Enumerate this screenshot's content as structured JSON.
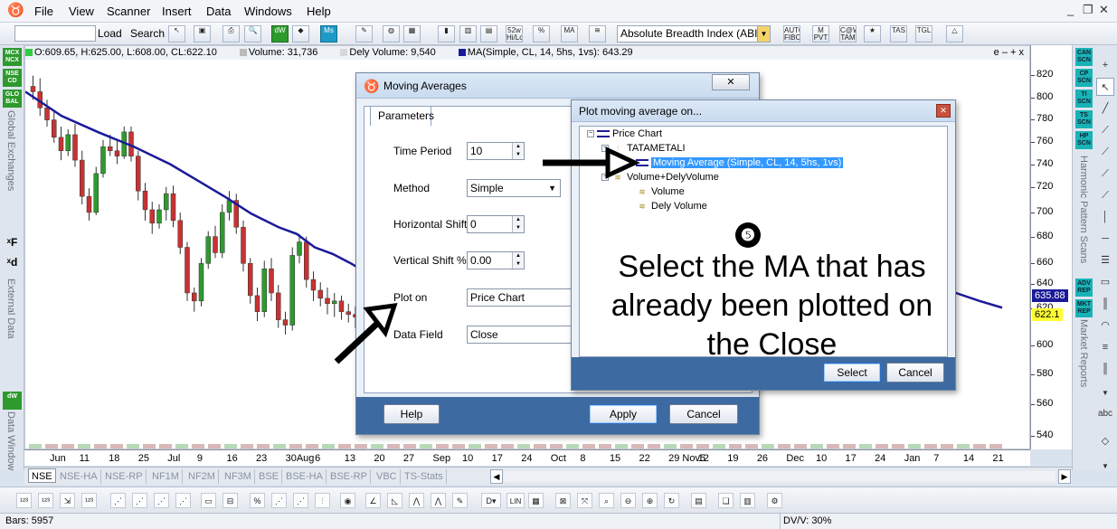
{
  "menu": {
    "items": [
      "File",
      "View",
      "Scanner",
      "Insert",
      "Data",
      "Windows",
      "Help"
    ],
    "window_controls": [
      "_",
      "❐",
      "✕"
    ]
  },
  "toolbar": {
    "load_label": "Load",
    "search_label": "Search",
    "indicator_combo": "Absolute Breadth Index (ABI",
    "icons": [
      "dW",
      "Ms",
      "52w Hi/Lo",
      "MA",
      "AUTO FIBO",
      "M PVT",
      "C@W TAM",
      "TAS",
      "TGL"
    ]
  },
  "left_strip": {
    "badges": [
      "MCX NCX",
      "NSE CD",
      "GLO BAL",
      "dW"
    ],
    "labels": [
      "Global Exchanges",
      "External Data",
      "Data Window"
    ],
    "xf": "ˣF",
    "xd": "ˣd"
  },
  "right_strip": {
    "badges": [
      "CAN SCN",
      "CP SCN",
      "TI SCN",
      "TS SCN",
      "HP SCN",
      "ADV REP",
      "MKT REP"
    ],
    "labels": [
      "Harmonic Pattern Scans",
      "Market Reports"
    ],
    "abc": "abc"
  },
  "legend": {
    "ohlc": "O:609.65, H:625.00, L:608.00, CL:622.10",
    "volume": "Volume: 31,736",
    "dely_volume": "Dely Volume: 9,540",
    "ma": "MA(Simple, CL, 14, 5hs, 1vs): 643.29",
    "controls": "e – + x",
    "colors": {
      "ohlc": "#2ecc40",
      "volume": "#bbbbbb",
      "dely": "#d8d8d8",
      "ma": "#1a1a99"
    }
  },
  "y_axis": {
    "ticks": [
      "820",
      "800",
      "780",
      "760",
      "740",
      "720",
      "700",
      "680",
      "660",
      "640",
      "620",
      "600",
      "580",
      "560",
      "540"
    ],
    "price_ma": "635.88",
    "price_close": "622.1"
  },
  "x_axis": {
    "ticks": [
      "Jun",
      "11",
      "18",
      "25",
      "Jul",
      "9",
      "16",
      "23",
      "30Aug",
      "6",
      "13",
      "20",
      "27",
      "Sep",
      "10",
      "17",
      "24",
      "Oct",
      "8",
      "15",
      "22",
      "29 Nov5",
      "12",
      "19",
      "26",
      "Dec",
      "10",
      "17",
      "24",
      "Jan",
      "7",
      "14",
      "21"
    ]
  },
  "chart_data": {
    "type": "candlestick",
    "ylim": [
      530,
      830
    ],
    "ma_color": "#1a1a99",
    "up_color": "#2e9a2e",
    "down_color": "#c83232",
    "candles": [
      [
        800,
        808,
        790,
        796
      ],
      [
        796,
        806,
        778,
        784
      ],
      [
        784,
        790,
        770,
        775
      ],
      [
        775,
        782,
        758,
        762
      ],
      [
        762,
        770,
        745,
        752
      ],
      [
        752,
        768,
        748,
        764
      ],
      [
        764,
        772,
        740,
        745
      ],
      [
        745,
        752,
        712,
        718
      ],
      [
        718,
        724,
        700,
        706
      ],
      [
        706,
        740,
        704,
        735
      ],
      [
        735,
        760,
        732,
        755
      ],
      [
        755,
        764,
        748,
        752
      ],
      [
        752,
        760,
        742,
        748
      ],
      [
        748,
        770,
        746,
        766
      ],
      [
        766,
        770,
        744,
        748
      ],
      [
        748,
        752,
        715,
        722
      ],
      [
        722,
        728,
        700,
        708
      ],
      [
        708,
        714,
        690,
        698
      ],
      [
        698,
        712,
        694,
        708
      ],
      [
        708,
        725,
        700,
        720
      ],
      [
        720,
        726,
        695,
        700
      ],
      [
        700,
        706,
        675,
        680
      ],
      [
        680,
        684,
        640,
        646
      ],
      [
        646,
        650,
        632,
        640
      ],
      [
        640,
        672,
        636,
        668
      ],
      [
        668,
        692,
        664,
        688
      ],
      [
        688,
        696,
        672,
        676
      ],
      [
        676,
        712,
        672,
        706
      ],
      [
        706,
        722,
        700,
        715
      ],
      [
        715,
        720,
        690,
        695
      ],
      [
        695,
        700,
        662,
        668
      ],
      [
        668,
        672,
        638,
        644
      ],
      [
        644,
        650,
        625,
        632
      ],
      [
        632,
        670,
        628,
        664
      ],
      [
        664,
        672,
        640,
        646
      ],
      [
        646,
        652,
        620,
        626
      ],
      [
        626,
        632,
        615,
        622
      ],
      [
        622,
        680,
        618,
        674
      ],
      [
        674,
        690,
        668,
        684
      ],
      [
        684,
        688,
        650,
        656
      ],
      [
        656,
        662,
        640,
        648
      ],
      [
        648,
        654,
        636,
        642
      ],
      [
        642,
        650,
        630,
        638
      ],
      [
        638,
        646,
        628,
        640
      ],
      [
        640,
        644,
        626,
        632
      ],
      [
        632,
        638,
        624,
        630
      ],
      [
        630,
        636,
        620,
        628
      ],
      [
        628,
        634,
        620,
        624
      ]
    ],
    "ma": [
      [
        0,
        796
      ],
      [
        40,
        778
      ],
      [
        80,
        766
      ],
      [
        120,
        755
      ],
      [
        160,
        742
      ],
      [
        190,
        730
      ],
      [
        220,
        718
      ],
      [
        250,
        705
      ],
      [
        280,
        695
      ],
      [
        300,
        690
      ],
      [
        320,
        680
      ],
      [
        340,
        675
      ],
      [
        360,
        668
      ],
      [
        380,
        660
      ],
      [
        395,
        652
      ],
      [
        1020,
        648
      ],
      [
        1055,
        640
      ],
      [
        1080,
        635
      ]
    ]
  },
  "bottom_tabs": [
    "NSE",
    "NSE-HA",
    "NSE-RP",
    "NF1M",
    "NF2M",
    "NF3M",
    "BSE",
    "BSE-HA",
    "BSE-RP",
    "VBC",
    "TS-Stats"
  ],
  "status": {
    "bars": "Bars: 5957",
    "dvv": "DV/V: 30%"
  },
  "ma_dialog": {
    "title": "Moving Averages",
    "close": "✕",
    "tab": "Parameters",
    "time_period_label": "Time Period",
    "time_period_value": "10",
    "method_label": "Method",
    "method_value": "Simple",
    "hshift_label": "Horizontal Shift",
    "hshift_value": "0",
    "vshift_label": "Vertical Shift %",
    "vshift_value": "0.00",
    "plot_on_label": "Plot on",
    "plot_on_value": "Price Chart",
    "data_field_label": "Data Field",
    "data_field_value": "Close",
    "help": "Help",
    "apply": "Apply",
    "cancel": "Cancel"
  },
  "plot_dialog": {
    "title": "Plot moving average on...",
    "close": "✕",
    "tree": {
      "price_chart": "Price Chart",
      "tatametali": "TATAMETALI",
      "ma_item": "Moving Average (Simple, CL, 14, 5hs, 1vs)",
      "vol_group": "Volume+DelyVolume",
      "volume": "Volume",
      "dely_volume": "Dely Volume"
    },
    "step_badge": "❺",
    "annotation": "Select the MA that has already been plotted on the Close",
    "select": "Select",
    "cancel": "Cancel"
  }
}
